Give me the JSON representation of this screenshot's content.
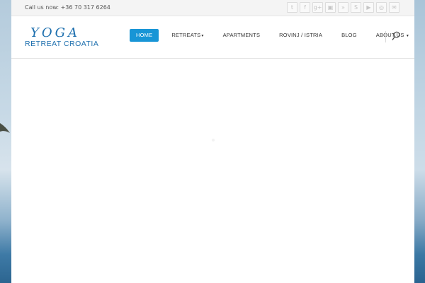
{
  "topbar": {
    "callus": "Call us now: +36 70 317 6264",
    "social": [
      {
        "icon": "twitter-icon",
        "glyph": "t"
      },
      {
        "icon": "facebook-icon",
        "glyph": "f"
      },
      {
        "icon": "googleplus-icon",
        "glyph": "g+"
      },
      {
        "icon": "flickr-icon",
        "glyph": "▣"
      },
      {
        "icon": "rss-icon",
        "glyph": "»"
      },
      {
        "icon": "skype-icon",
        "glyph": "S"
      },
      {
        "icon": "youtube-icon",
        "glyph": "▶"
      },
      {
        "icon": "dribbble-icon",
        "glyph": "◎"
      },
      {
        "icon": "email-icon",
        "glyph": "✉"
      }
    ]
  },
  "logo": {
    "top": "YOGA",
    "bottom": "RETREAT CROATIA"
  },
  "nav": {
    "home": "HOME",
    "retreats": "RETREATS",
    "apartments": "APARTMENTS",
    "rovinj": "ROVINJ / ISTRIA",
    "blog": "BLOG",
    "about": "ABOUT US"
  },
  "colors": {
    "accent": "#1895d6",
    "logo": "#1d6fae"
  }
}
